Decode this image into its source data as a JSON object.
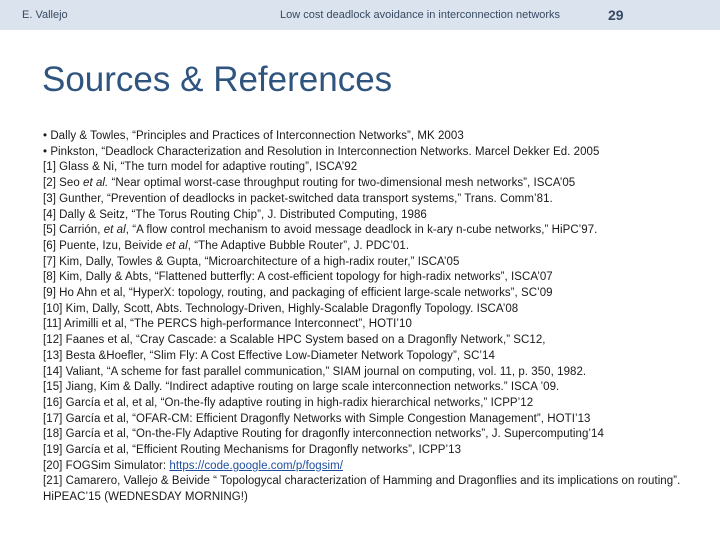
{
  "header": {
    "author": "E. Vallejo",
    "title": "Low cost deadlock avoidance in interconnection networks",
    "page_number": "29"
  },
  "slide": {
    "title": "Sources & References"
  },
  "refs": {
    "b1": "• Dally & Towles, “Principles and Practices of Interconnection Networks”, MK 2003",
    "b2": "• Pinkston, “Deadlock Characterization and Resolution in Interconnection Networks. Marcel Dekker Ed. 2005",
    "r1": "[1] Glass & Ni, “The turn model for adaptive routing”, ISCA’92",
    "r2_pre": "[2] Seo ",
    "r2_em": "et al.",
    "r2_post": " “Near optimal worst-case throughput routing for two-dimensional mesh networks”, ISCA’05",
    "r3": "[3] Gunther, “Prevention of deadlocks in packet-switched data transport systems,” Trans. Comm’81.",
    "r4": "[4] Dally & Seitz, “The Torus Routing Chip”, J. Distributed Computing, 1986",
    "r5_pre": "[5] Carrión, ",
    "r5_em": "et al",
    "r5_post": ", “A flow control mechanism to avoid message deadlock in k-ary n-cube networks,” HiPC’97.",
    "r6_pre": "[6] Puente, Izu, Beivide ",
    "r6_em": "et al",
    "r6_post": ", “The Adaptive Bubble Router”, J. PDC’01.",
    "r7": "[7] Kim, Dally, Towles & Gupta, “Microarchitecture of a high-radix router,” ISCA’05",
    "r8": "[8] Kim, Dally & Abts, “Flattened butterfly: A cost-efficient topology for high-radix networks”, ISCA’07",
    "r9": "[9] Ho Ahn et al, “HyperX: topology, routing, and packaging of efficient large-scale networks”, SC’09",
    "r10": "[10] Kim, Dally, Scott, Abts. Technology-Driven, Highly-Scalable Dragonfly Topology. ISCA’08",
    "r11": "[11] Arimilli et al, “The PERCS high-performance Interconnect”, HOTI’10",
    "r12": "[12] Faanes et al, “Cray Cascade: a Scalable HPC System based on a Dragonfly Network,” SC12,",
    "r13": "[13] Besta &Hoefler, “Slim Fly: A Cost Effective Low-Diameter Network Topology”, SC’14",
    "r14": "[14] Valiant, “A scheme for fast parallel communication,” SIAM journal on computing, vol. 11, p. 350, 1982.",
    "r15": "[15] Jiang, Kim & Dally. “Indirect adaptive routing on large scale interconnection networks.” ISCA ’09.",
    "r16": "[16] García et al, et al, “On-the-fly adaptive routing in high-radix hierarchical networks,” ICPP’12",
    "r17": "[17] García et al, “OFAR-CM: Efficient Dragonfly Networks with Simple Congestion Management”, HOTI’13",
    "r18": "[18] García et al, “On-the-Fly Adaptive Routing for dragonfly interconnection networks”, J. Supercomputing’14",
    "r19": "[19] García et al, “Efficient Routing Mechanisms for Dragonfly networks”, ICPP’13",
    "r20_pre": "[20] FOGSim Simulator: ",
    "r20_link": "https://code.google.com/p/fogsim/",
    "r21": "[21] Camarero, Vallejo & Beivide “ Topologycal characterization of Hamming and Dragonflies and its implications on routing”. HiPEAC’15 (WEDNESDAY MORNING!)"
  }
}
